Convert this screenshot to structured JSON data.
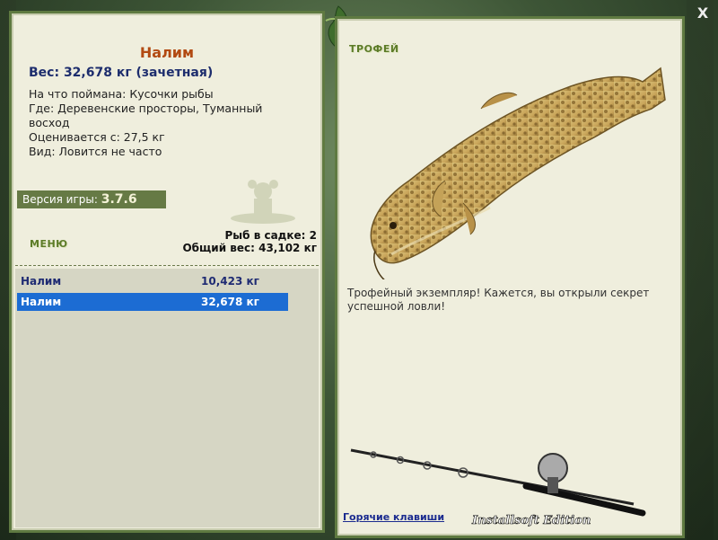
{
  "fish": {
    "name": "Налим",
    "weight": "Вес: 32,678 кг (зачетная)",
    "caught_on": "На что поймана: Кусочки рыбы",
    "where": "Где: Деревенские просторы, Туманный восход",
    "valued_from": "Оценивается с: 27,5 кг",
    "kind": "Вид: Ловится не часто"
  },
  "version": {
    "label": "Версия игры:",
    "value": "3.7.6"
  },
  "menu_label": "МЕНЮ",
  "stats": {
    "count": "Рыб в садке: 2",
    "total": "Общий вес: 43,102 кг"
  },
  "catch_list": [
    {
      "name": "Налим",
      "weight": "10,423 кг"
    },
    {
      "name": "Налим",
      "weight": "32,678 кг"
    }
  ],
  "trophy": {
    "label": "ТРОФЕЙ",
    "text": "Трофейный экземпляр! Кажется, вы открыли секрет успешной ловли!"
  },
  "hotkeys_label": "Горячие клавиши",
  "close_label": "X",
  "watermark_text": "Installsoft Edition",
  "colors": {
    "panel_bg": "#efeedd",
    "panel_border": "#5f7a41",
    "selection": "#1c6cd3",
    "title": "#b24a12"
  }
}
